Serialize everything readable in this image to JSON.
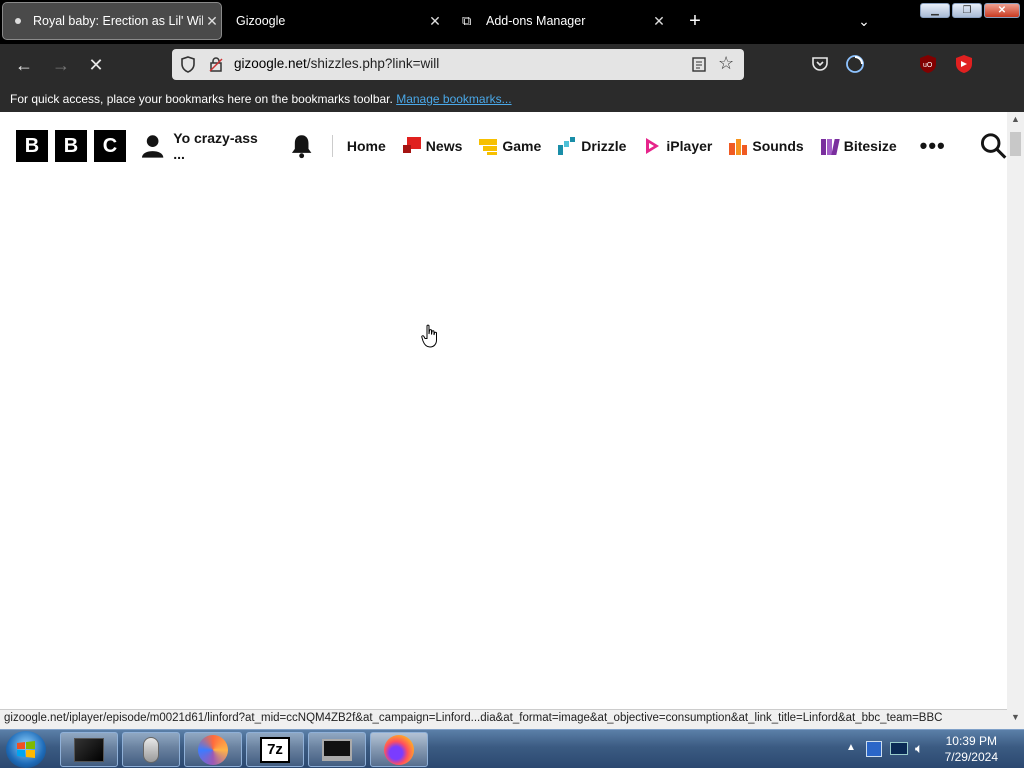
{
  "browser": {
    "tabs": [
      {
        "title": "Royal baby: Erection as Lil' Will",
        "active": true
      },
      {
        "title": "Gizoogle",
        "active": false
      },
      {
        "title": "Add-ons Manager",
        "active": false
      }
    ],
    "url_host": "gizoogle.net",
    "url_path": "/shizzles.php?link=will",
    "bookmarks_bar_text": "For quick access, place your bookmarks here on the bookmarks toolbar.",
    "bookmarks_bar_link": "Manage bookmarks..."
  },
  "bbc": {
    "logo_letters": [
      "B",
      "B",
      "C"
    ],
    "account_label": "Yo crazy-ass ...",
    "nav": [
      {
        "label": "Home",
        "icon": "none"
      },
      {
        "label": "News",
        "icon": "news-icon",
        "color": "#e0201e"
      },
      {
        "label": "Game",
        "icon": "game-icon",
        "color": "#f7c000"
      },
      {
        "label": "Drizzle",
        "icon": "weather-icon",
        "color": "#1a8ea8"
      },
      {
        "label": "iPlayer",
        "icon": "iplayer-icon",
        "color": "#e6248b"
      },
      {
        "label": "Sounds",
        "icon": "sounds-icon",
        "color": "#f05a22"
      },
      {
        "label": "Bitesize",
        "icon": "bitesize-icon",
        "color": "#7a2f9e"
      }
    ]
  },
  "status_url": "gizoogle.net/iplayer/episode/m0021d61/linford?at_mid=ccNQM4ZB2f&at_campaign=Linford...dia&at_format=image&at_objective=consumption&at_link_title=Linford&at_bbc_team=BBC",
  "taskbar": {
    "time": "10:39 PM",
    "date": "7/29/2024",
    "apps": [
      "window-icon",
      "mouse-icon",
      "spiral-icon",
      "7zip-icon",
      "monitor-icon",
      "firefox-icon"
    ]
  }
}
